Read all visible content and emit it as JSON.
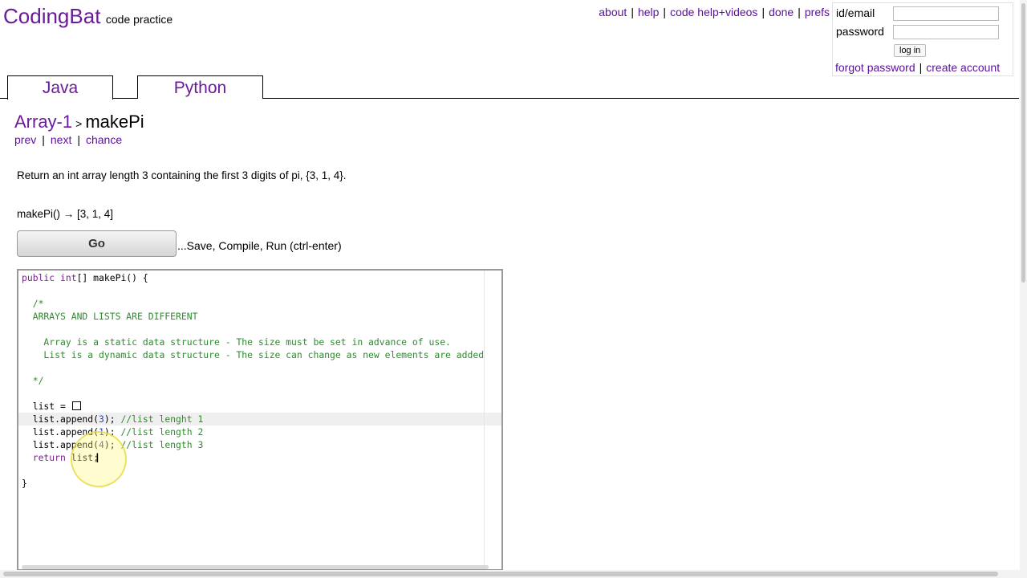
{
  "brand": {
    "name": "CodingBat",
    "tagline": "code practice"
  },
  "topnav": [
    "about",
    "help",
    "code help+videos",
    "done",
    "prefs"
  ],
  "login": {
    "email_label": "id/email",
    "password_label": "password",
    "email_value": "",
    "password_value": "",
    "button": "log in",
    "forgot": "forgot password",
    "create": "create account"
  },
  "tabs": [
    "Java",
    "Python"
  ],
  "problem": {
    "category": "Array-1",
    "name": "makePi",
    "prev": "prev",
    "next": "next",
    "chance": "chance",
    "description": "Return an int array length 3 containing the first 3 digits of pi, {3, 1, 4}.",
    "example": "makePi() → [3, 1, 4]"
  },
  "go": {
    "label": "Go",
    "hint": "...Save, Compile, Run (ctrl-enter)"
  },
  "code": {
    "l1_kw": "public int",
    "l1_rest": "[] makePi() {",
    "c_open": "  /*",
    "c_title": "  ARRAYS AND LISTS ARE DIFFERENT",
    "c_array": "    Array is a static data structure - The size must be set in advance of use.",
    "c_list": "    List is a dynamic data structure - The size can change as new elements are added",
    "c_close": "  */",
    "list_init": "  list = ",
    "a1_pre": "  list.append(",
    "a1_num": "3",
    "a1_post": ");",
    "a1_cm": " //list lenght 1",
    "a2_pre": "  list.append(",
    "a2_num": "1",
    "a2_post": ");",
    "a2_cm": " //list length 2",
    "a3_pre": "  list.append(",
    "a3_num": "4",
    "a3_post": ");",
    "a3_cm": " //list length 3",
    "ret_kw": "  return",
    "ret_rest": " list;",
    "close": "}"
  }
}
